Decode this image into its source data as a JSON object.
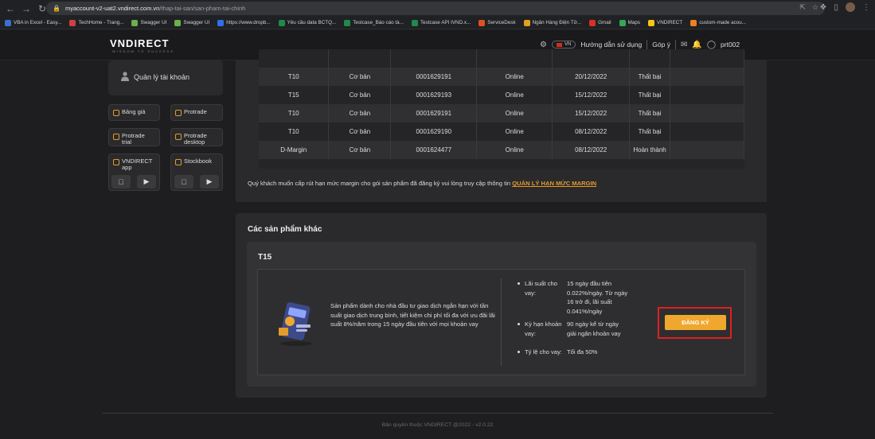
{
  "browser": {
    "url_host": "myaccount-v2-uat2.vndirect.com.vn",
    "url_path": "/thap-tai-san/san-pham-tai-chinh",
    "bookmarks": [
      {
        "label": "VBA in Excel - Easy...",
        "color": "#3b6fd4"
      },
      {
        "label": "TechHome - Trang...",
        "color": "#d04040"
      },
      {
        "label": "Swagger UI",
        "color": "#6ab04c"
      },
      {
        "label": "Swagger UI",
        "color": "#6ab04c"
      },
      {
        "label": "https://www.dropb...",
        "color": "#2f6fea"
      },
      {
        "label": "Yêu cầu data BCTQ...",
        "color": "#1e8a4c"
      },
      {
        "label": "Testcase_Báo cáo tà...",
        "color": "#1e8a4c"
      },
      {
        "label": "Testcase API IVND.x...",
        "color": "#1e8a4c"
      },
      {
        "label": "ServiceDesk",
        "color": "#e05020"
      },
      {
        "label": "Ngân Hàng Điện Tử...",
        "color": "#e3a020"
      },
      {
        "label": "Gmail",
        "color": "#d93025"
      },
      {
        "label": "Maps",
        "color": "#34a853"
      },
      {
        "label": "VNDIRECT",
        "color": "#f5c518"
      },
      {
        "label": "custom-made acou...",
        "color": "#f08020"
      }
    ]
  },
  "header": {
    "logo": "VNDIRECT",
    "logo_sub": "WISDOM TO SUCCESS",
    "lang": "VN",
    "guide": "Hướng dẫn sử dụng",
    "feedback": "Góp ý",
    "username": "prt002"
  },
  "sidebar": {
    "account_label": "Quản lý tài khoản",
    "tiles": [
      "Bảng giá",
      "Protrade",
      "Protrade trial",
      "Protrade desktop",
      "VNDIRECT app",
      "Stockbook"
    ]
  },
  "history_rows": [
    [
      "T10",
      "Cơ bản",
      "0001629191",
      "Online",
      "20/12/2022",
      "Thất bại",
      ""
    ],
    [
      "T15",
      "Cơ bản",
      "0001629193",
      "Online",
      "15/12/2022",
      "Thất bại",
      ""
    ],
    [
      "T10",
      "Cơ bản",
      "0001629191",
      "Online",
      "15/12/2022",
      "Thất bại",
      ""
    ],
    [
      "T10",
      "Cơ bản",
      "0001629190",
      "Online",
      "08/12/2022",
      "Thất bại",
      ""
    ],
    [
      "D-Margin",
      "Cơ bản",
      "0001624477",
      "Online",
      "08/12/2022",
      "Hoàn thành",
      ""
    ]
  ],
  "note": {
    "text": "Quý khách muốn cấp rút hạn mức margin cho gói sản phẩm đã đăng ký vui lòng truy cập thông tin",
    "link": "QUẢN LÝ HẠN MỨC MARGIN"
  },
  "other_products": {
    "title": "Các sản phẩm khác",
    "product": {
      "name": "T15",
      "description": "Sản phẩm dành cho nhà đầu tư giao dịch ngắn hạn với tần suất giao dịch trung bình, tiết kiệm chi phí tối đa với ưu đãi lãi suất 8%/năm trong 15 ngày đầu tiên với mọi khoản vay",
      "attrs": [
        {
          "key": "Lãi suất cho vay:",
          "value": "15 ngày đầu tiên 0.022%/ngày. Từ ngày 16 trở đi, lãi suất 0.041%/ngày"
        },
        {
          "key": "Kỳ hạn khoản vay:",
          "value": "90 ngày kể từ ngày giải ngân khoản vay"
        },
        {
          "key": "Tỷ lệ cho vay:",
          "value": "Tối đa 50%"
        }
      ],
      "register_label": "ĐĂNG KÝ"
    }
  },
  "footer": "Bản quyền thuộc VNDIRECT @2022 - v2.0.22",
  "colors": {
    "accent": "#f0a72e",
    "highlight_border": "#e02020",
    "bg": "#1e1e20"
  }
}
